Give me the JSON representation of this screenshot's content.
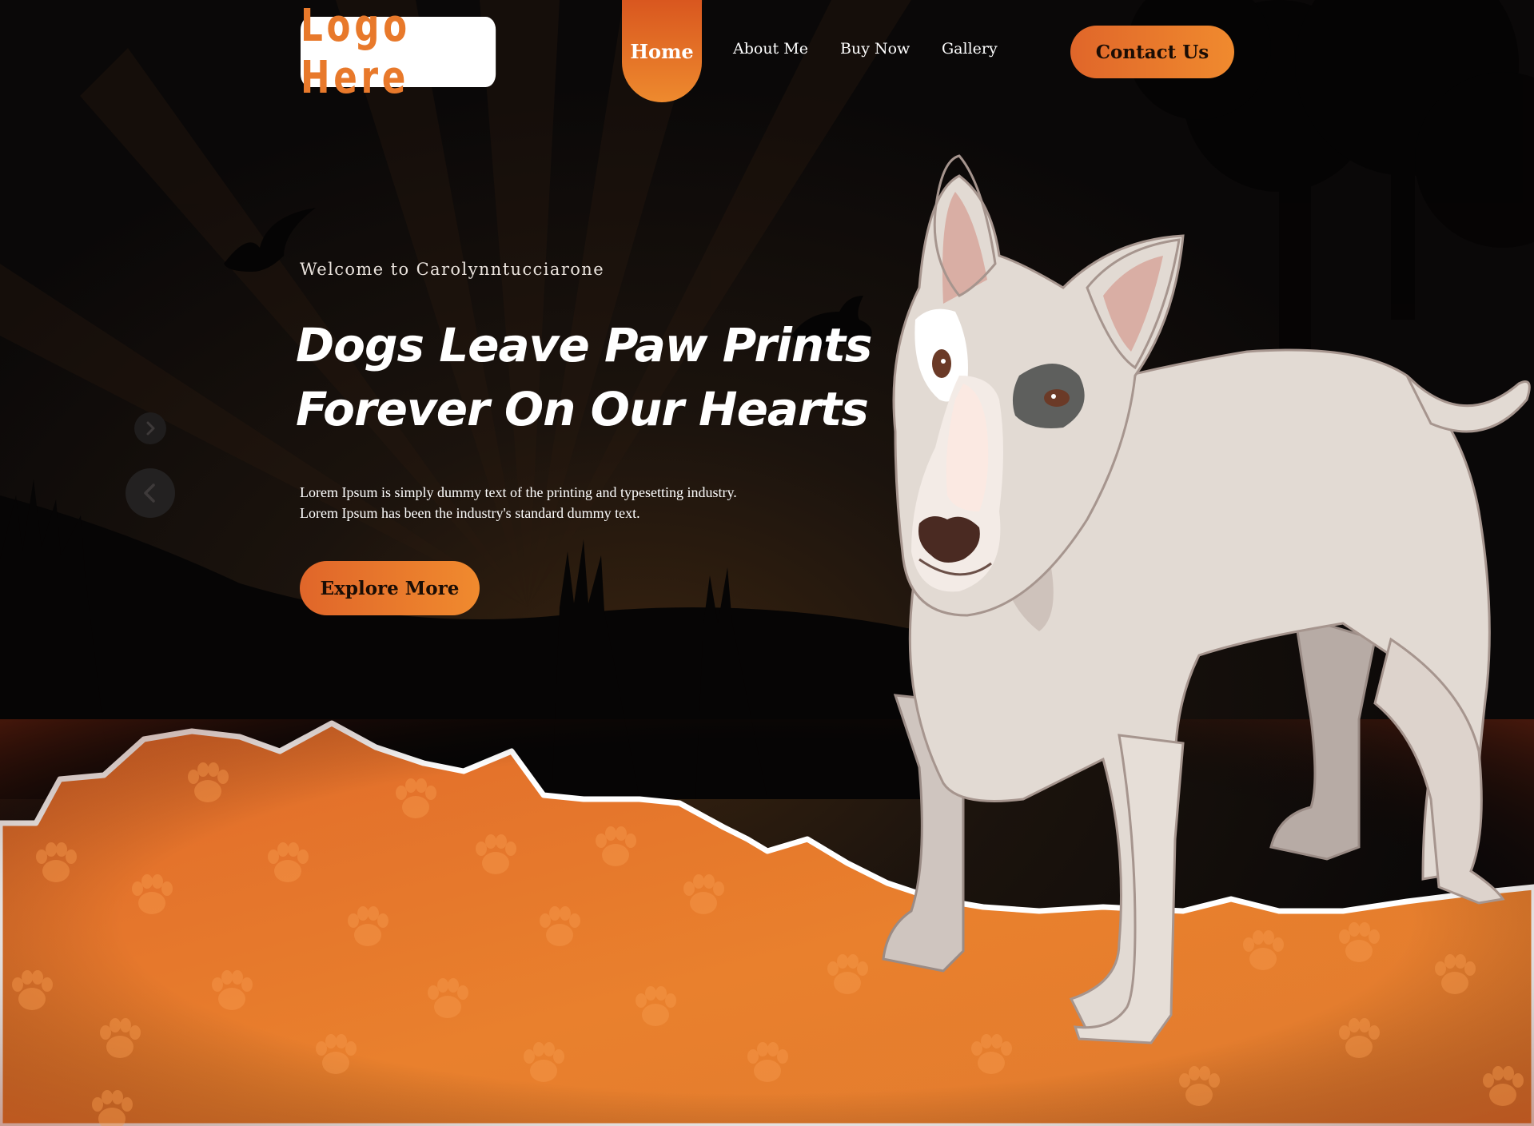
{
  "header": {
    "logo_text": "Logo Here",
    "nav": {
      "home": "Home",
      "about": "About Me",
      "buy": "Buy Now",
      "gallery": "Gallery"
    },
    "contact_label": "Contact Us"
  },
  "hero": {
    "welcome": "Welcome to Carolynntucciarone",
    "headline_line1": "Dogs Leave Paw Prints",
    "headline_line2": "Forever On Our Hearts",
    "description_line1": "Lorem Ipsum is simply dummy text of the printing and typesetting industry.",
    "description_line2": "Lorem Ipsum has been the industry's standard dummy text.",
    "cta_label": "Explore More"
  },
  "slider": {
    "next_icon": "chevron-right-icon",
    "prev_icon": "chevron-left-icon"
  },
  "colors": {
    "accent": "#ed7f2c",
    "accent_dark": "#d9571f",
    "background": "#0c0a0a",
    "dog_body": "#e2dad3"
  }
}
